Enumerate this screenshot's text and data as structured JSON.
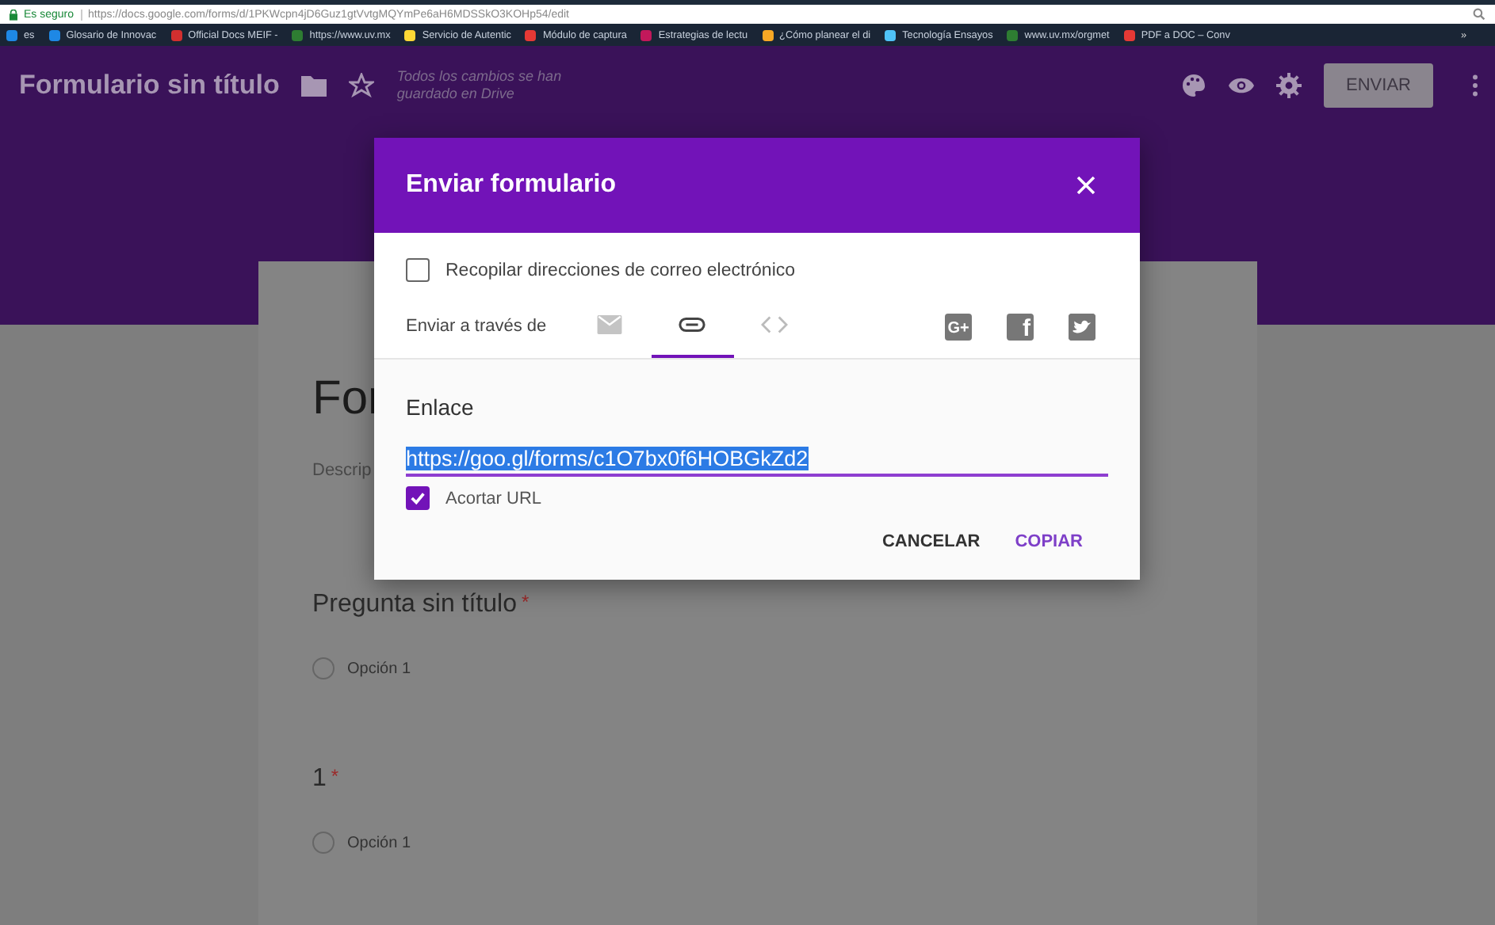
{
  "browser": {
    "security": "Es seguro",
    "url": "https://docs.google.com/forms/d/1PKWcpn4jD6Guz1gtVvtgMQYmPe6aH6MDSSkO3KOHp54/edit",
    "bookmarks": [
      {
        "label": "es",
        "color": "#1e88e5"
      },
      {
        "label": "Glosario de Innovac",
        "color": "#1e88e5"
      },
      {
        "label": "Official Docs MEIF -",
        "color": "#d32f2f"
      },
      {
        "label": "https://www.uv.mx",
        "color": "#2e7d32"
      },
      {
        "label": "Servicio de Autentic",
        "color": "#fdd835"
      },
      {
        "label": "Módulo de captura",
        "color": "#e53935"
      },
      {
        "label": "Estrategias de lectu",
        "color": "#c2185b"
      },
      {
        "label": "¿Cómo planear el di",
        "color": "#f9a825"
      },
      {
        "label": "Tecnología Ensayos",
        "color": "#4fc3f7"
      },
      {
        "label": "www.uv.mx/orgmet",
        "color": "#2e7d32"
      },
      {
        "label": "PDF a DOC – Conv",
        "color": "#e53935"
      }
    ],
    "overflow": "»"
  },
  "header": {
    "title": "Formulario sin título",
    "autosave": "Todos los cambios se han guardado en Drive",
    "send_button": "ENVIAR"
  },
  "form": {
    "title_partial": "For",
    "description_partial": "Descrip",
    "questions": [
      {
        "title": "Pregunta sin título",
        "required_mark": "*",
        "options": [
          {
            "label": "Opción 1",
            "selected": false
          }
        ]
      },
      {
        "title": "1",
        "required_mark": "*",
        "options": [
          {
            "label": "Opción 1",
            "selected": false
          }
        ]
      }
    ]
  },
  "dialog": {
    "title": "Enviar formulario",
    "collect_emails": {
      "label": "Recopilar direcciones de correo electrónico",
      "checked": false
    },
    "send_via_label": "Enviar a través de",
    "methods": [
      {
        "kind": "email",
        "selected": false
      },
      {
        "kind": "link",
        "selected": true
      },
      {
        "kind": "embed",
        "selected": false
      }
    ],
    "social": [
      {
        "kind": "gplus",
        "glyph": "G+"
      },
      {
        "kind": "facebook",
        "glyph": "f"
      },
      {
        "kind": "twitter"
      }
    ],
    "link_section": {
      "title": "Enlace",
      "url": "https://goo.gl/forms/c1O7bx0f6HOBGkZd2",
      "shorten": {
        "label": "Acortar URL",
        "checked": true
      }
    },
    "buttons": [
      {
        "label": "CANCELAR",
        "kind": "text"
      },
      {
        "label": "COPIAR",
        "kind": "primary"
      }
    ]
  }
}
